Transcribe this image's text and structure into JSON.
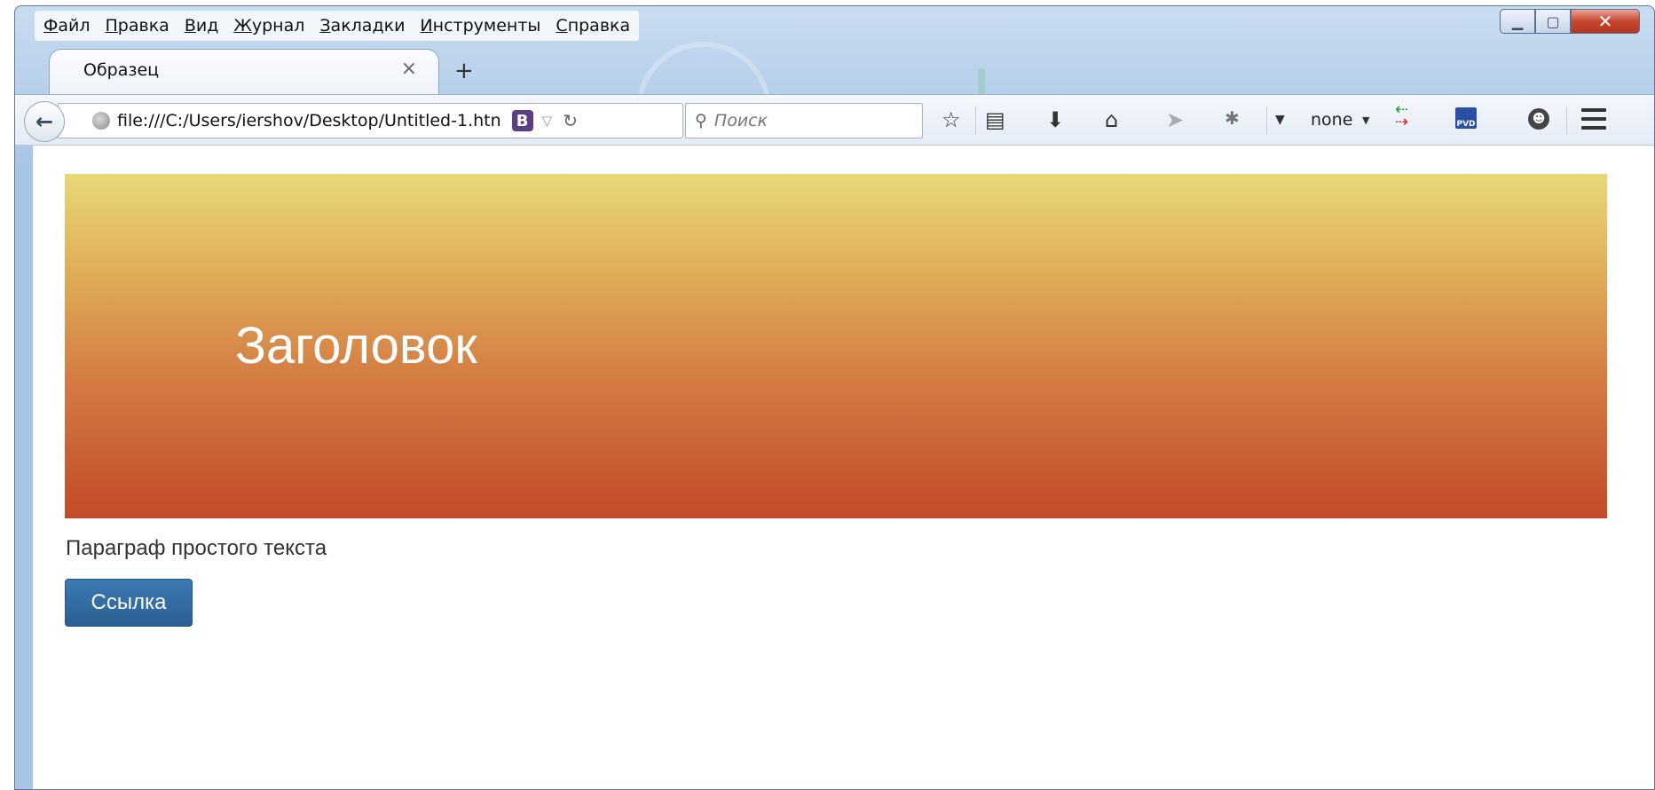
{
  "menu": {
    "items": [
      {
        "acc": "Ф",
        "rest": "айл"
      },
      {
        "acc": "П",
        "rest": "равка"
      },
      {
        "acc": "В",
        "rest": "ид"
      },
      {
        "acc": "Ж",
        "rest": "урнал"
      },
      {
        "acc": "З",
        "rest": "акладки"
      },
      {
        "acc": "И",
        "rest": "нструменты"
      },
      {
        "acc": "С",
        "rest": "правка"
      }
    ]
  },
  "tab": {
    "title": "Образец",
    "close": "×",
    "new_tab": "+"
  },
  "navbar": {
    "url": "file:///C:/Users/iershov/Desktop/Untitled-1.htn",
    "bootstrap_badge": "B",
    "search_placeholder": "Поиск",
    "proxy_label": "none"
  },
  "icons": {
    "back": "arrow-left-icon",
    "star": "☆",
    "reader": "▤",
    "download": "⬇",
    "home": "⌂"
  },
  "page": {
    "heading": "Заголовок",
    "paragraph": "Параграф простого текста",
    "link_label": "Ссылка"
  },
  "colors": {
    "jumbotron_top": "#e8d877",
    "jumbotron_bottom": "#c34b27",
    "button": "#336ba3"
  }
}
